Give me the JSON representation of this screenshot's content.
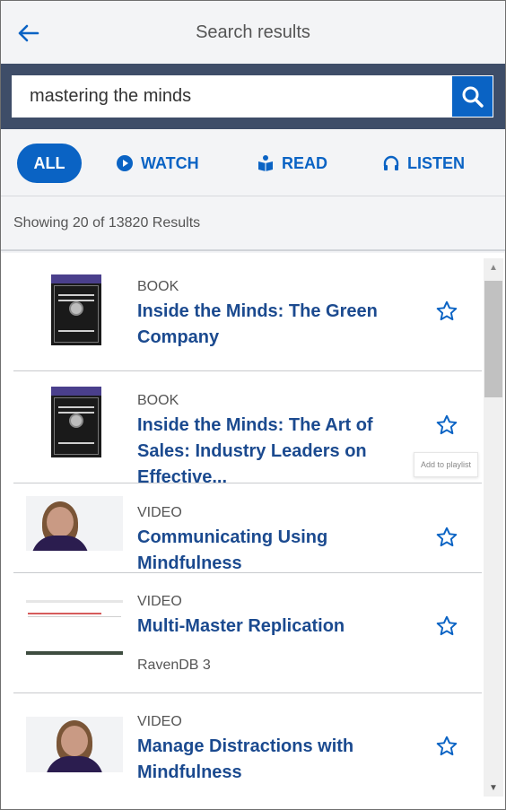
{
  "header": {
    "title": "Search results"
  },
  "search": {
    "value": "mastering the minds"
  },
  "tabs": [
    {
      "label": "ALL"
    },
    {
      "label": "WATCH"
    },
    {
      "label": "READ"
    },
    {
      "label": "LISTEN"
    }
  ],
  "results_count": "Showing 20 of 13820 Results",
  "tooltip": "Add to playlist",
  "results": [
    {
      "type": "BOOK",
      "title": "Inside the Minds: The Green Company"
    },
    {
      "type": "BOOK",
      "title": "Inside the Minds: The Art of Sales: Industry Leaders on Effective..."
    },
    {
      "type": "VIDEO",
      "title": "Communicating Using Mindfulness"
    },
    {
      "type": "VIDEO",
      "title": "Multi-Master Replication",
      "meta": "RavenDB  3"
    },
    {
      "type": "VIDEO",
      "title": "Manage Distractions with Mindfulness"
    }
  ],
  "colors": {
    "accent": "#0a63c4",
    "header_band": "#3e4d68",
    "title_text": "#1b4a8f"
  }
}
